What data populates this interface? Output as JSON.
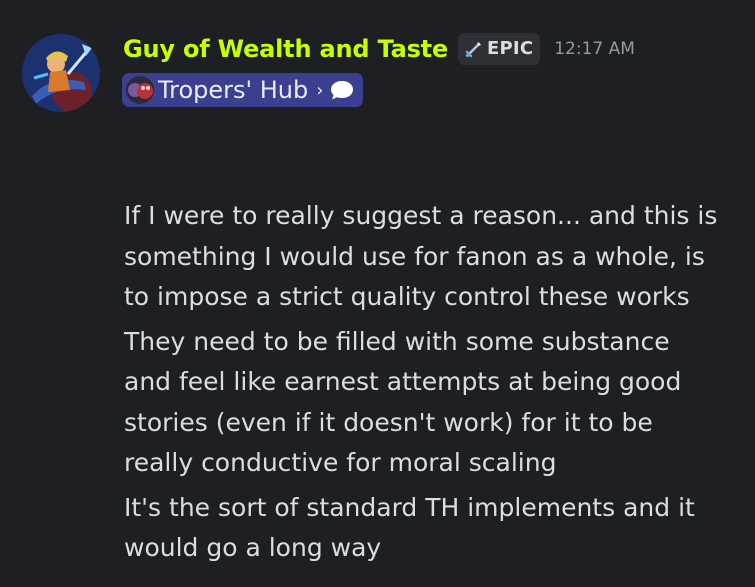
{
  "message": {
    "author": "Guy of Wealth and Taste",
    "tag": {
      "label": "EPIC",
      "icon": "sword-icon"
    },
    "timestamp": "12:17 AM",
    "server_chip": {
      "label": "Tropers' Hub",
      "chevron": "›",
      "icon": "chat-bubble-icon"
    },
    "paragraphs": [
      {
        "lines": [
          "If I were to really suggest a reason... and this is",
          "something I would use for fanon as a whole, is",
          "to impose a strict quality control these works"
        ]
      },
      {
        "lines": [
          "They need to be filled with some substance",
          "and feel like earnest attempts at being good",
          "stories (even if it doesn't work) for it to be",
          "really conductive for moral scaling"
        ]
      },
      {
        "lines": [
          "It's the sort of standard TH implements and it",
          "would go a long way"
        ]
      }
    ]
  },
  "colors": {
    "background": "#1e1f22",
    "username": "#c8ff00",
    "text": "#dbdee1",
    "timestamp": "#949ba4",
    "chip": "#3b3f8f"
  }
}
